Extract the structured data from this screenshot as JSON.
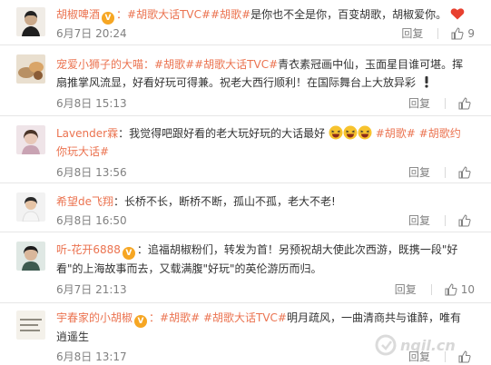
{
  "comments": [
    {
      "user": "胡椒啤酒",
      "badge": "V",
      "segments": [
        {
          "kind": "tag",
          "text": "：#胡歌大话TVC##胡歌#"
        },
        {
          "kind": "text",
          "text": "是你也不全是你，百变胡歌，胡椒爱你。"
        }
      ],
      "time": "6月7日 20:24",
      "reply_label": "回复",
      "likes": "9"
    },
    {
      "user": "宠爱小狮子的大喵",
      "badge": "",
      "segments": [
        {
          "kind": "tag",
          "text": "：#胡歌##胡歌大话TVC#"
        },
        {
          "kind": "text",
          "text": "青衣素冠画中仙，玉面星目谁可堪。挥扇推掌风流显，好看好玩可得兼。祝老大西行顺利！在国际舞台上大放异彩"
        }
      ],
      "time": "6月8日 15:13",
      "reply_label": "回复",
      "likes": ""
    },
    {
      "user": "Lavender霖",
      "badge": "",
      "segments": [
        {
          "kind": "text",
          "text": "：我觉得吧跟好看的老大玩好玩的大话最好"
        },
        {
          "kind": "tag",
          "text": "#胡歌# #胡歌约你玩大话#"
        }
      ],
      "time": "6月8日 13:56",
      "reply_label": "回复",
      "likes": ""
    },
    {
      "user": "希望de飞翔",
      "badge": "",
      "segments": [
        {
          "kind": "text",
          "text": "：长桥不长，断桥不断，孤山不孤，老大不老!"
        }
      ],
      "time": "6月8日 16:50",
      "reply_label": "回复",
      "likes": ""
    },
    {
      "user": "听-花开6888",
      "badge": "V",
      "segments": [
        {
          "kind": "text",
          "text": "：追福胡椒粉们，转发为首！另预祝胡大使此次西游，既携一段\"好看\"的上海故事而去，又载满腹\"好玩\"的英伦游历而归。"
        }
      ],
      "time": "6月7日 21:13",
      "reply_label": "回复",
      "likes": "10"
    },
    {
      "user": "宇春家的小胡椒",
      "badge": "V",
      "segments": [
        {
          "kind": "tag",
          "text": "：#胡歌# #胡歌大话TVC#"
        },
        {
          "kind": "text",
          "text": "明月疏风，一曲清商共与谁醉，唯有逍遥生"
        }
      ],
      "time": "6月8日 13:17",
      "reply_label": "回复",
      "likes": ""
    }
  ],
  "watermark": "nqil.cn",
  "colors": {
    "accent": "#eb7350",
    "meta": "#808080",
    "text": "#333333"
  }
}
